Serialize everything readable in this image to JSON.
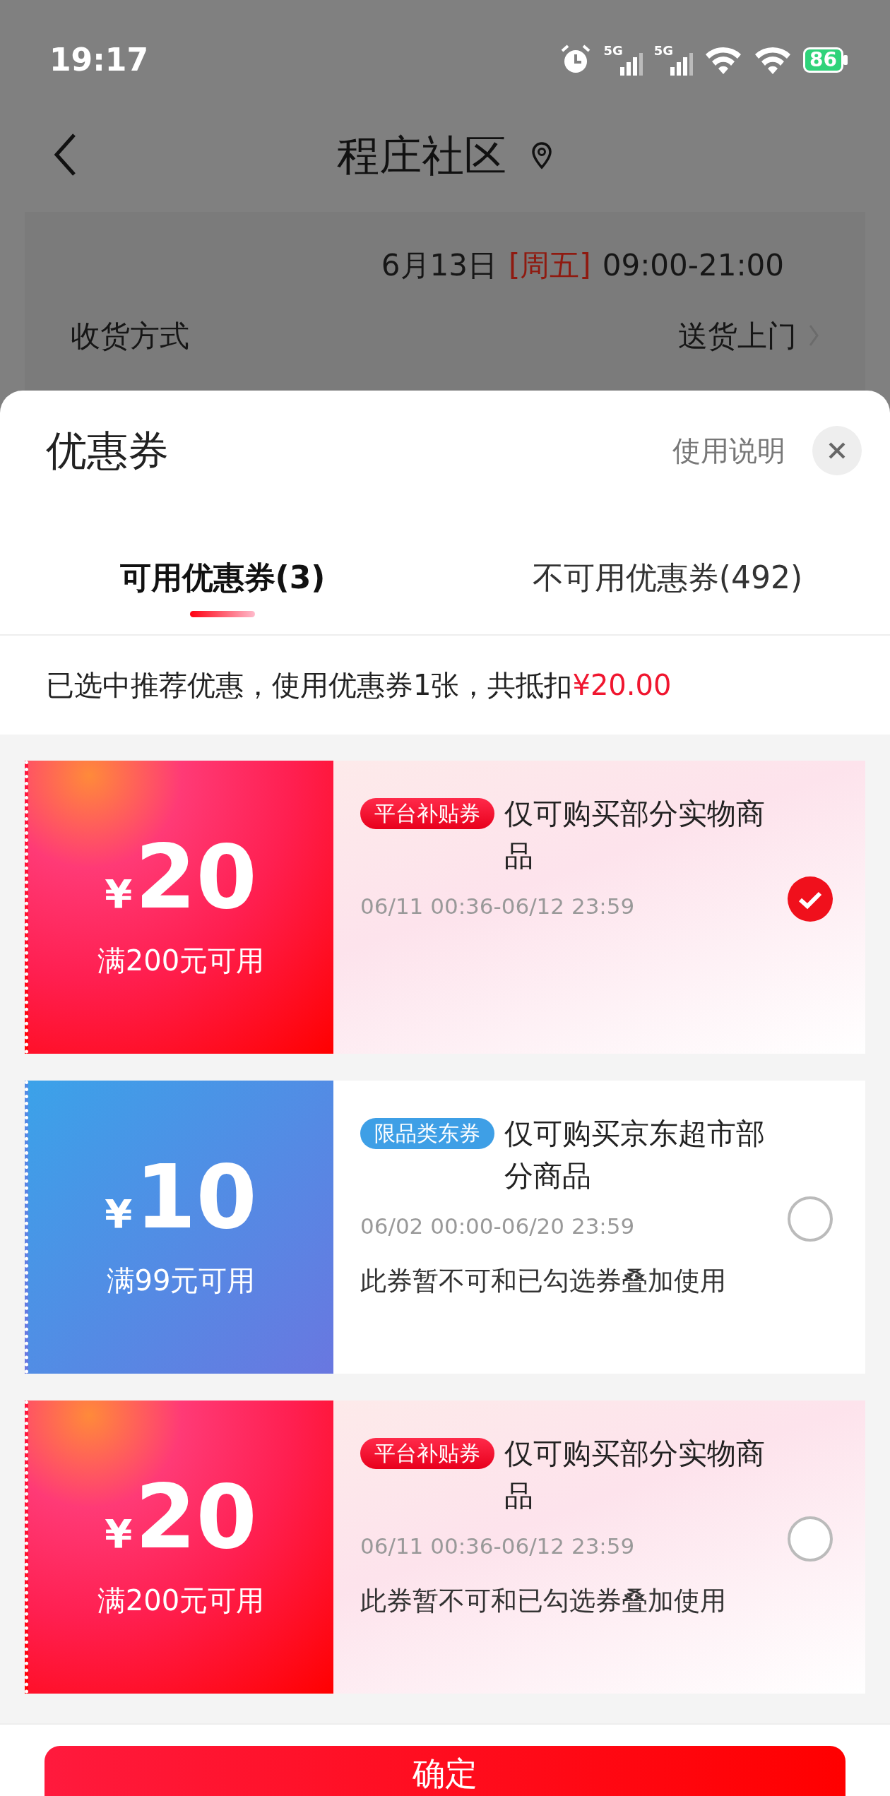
{
  "status_bar": {
    "time": "19:17",
    "networks": [
      "5G",
      "5G"
    ],
    "battery": "86"
  },
  "header": {
    "title": "程庄社区"
  },
  "delivery": {
    "rows": [
      {
        "date": "6月13日",
        "weekday": "[周五]",
        "hours": "09:00-21:00"
      },
      {
        "label": "收货方式",
        "value": "送货上门"
      }
    ]
  },
  "sheet": {
    "title": "优惠券",
    "help": "使用说明",
    "tabs": [
      {
        "label": "可用优惠券(3)",
        "selected": true
      },
      {
        "label": "不可用优惠券(492)",
        "selected": false
      }
    ],
    "summary": {
      "text": "已选中推荐优惠，使用优惠券1张，共抵扣",
      "amount": "¥20.00"
    },
    "coupons": [
      {
        "kind": "platform",
        "currency": "¥",
        "amount": "20",
        "threshold": "满200元可用",
        "tag": "平台补贴券",
        "title": "仅可购买部分实物商品",
        "validity": "06/11 00:36-06/12 23:59",
        "selected": true
      },
      {
        "kind": "category",
        "currency": "¥",
        "amount": "10",
        "threshold": "满99元可用",
        "tag": "限品类东券",
        "title": "仅可购买京东超市部分商品",
        "validity": "06/02 00:00-06/20 23:59",
        "note": "此券暂不可和已勾选券叠加使用",
        "selected": false
      },
      {
        "kind": "platform",
        "currency": "¥",
        "amount": "20",
        "threshold": "满200元可用",
        "tag": "平台补贴券",
        "title": "仅可购买部分实物商品",
        "validity": "06/11 00:36-06/12 23:59",
        "note": "此券暂不可和已勾选券叠加使用",
        "selected": false
      }
    ],
    "confirm": "确定"
  }
}
